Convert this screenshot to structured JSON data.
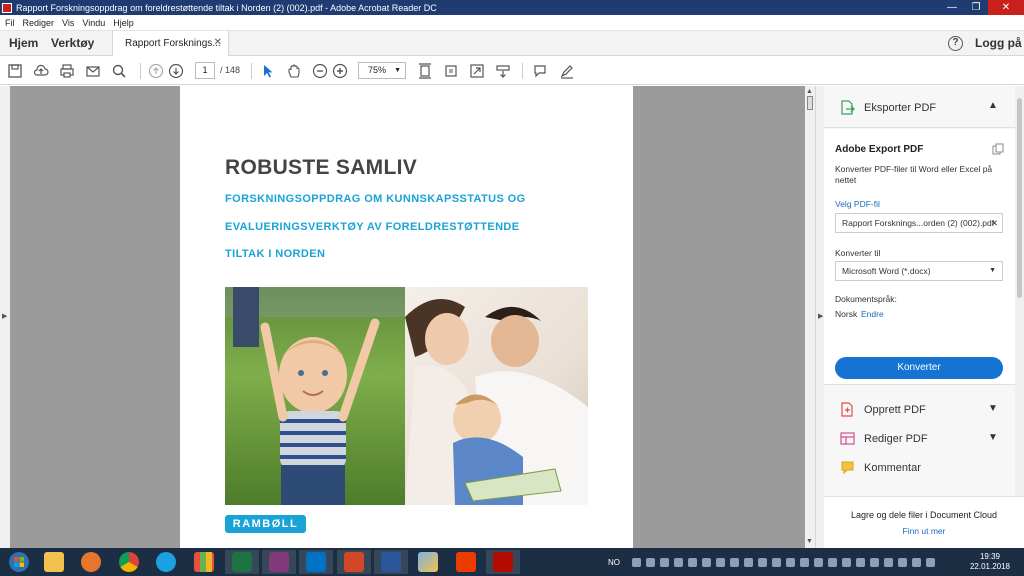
{
  "window": {
    "title": "Rapport Forskningsoppdrag om foreldrestøttende tiltak i Norden (2) (002).pdf - Adobe Acrobat Reader DC"
  },
  "menu": [
    "Fil",
    "Rediger",
    "Vis",
    "Vindu",
    "Hjelp"
  ],
  "tabs": {
    "home": "Hjem",
    "tools": "Verktøy",
    "document": "Rapport Forsknings...",
    "login": "Logg på"
  },
  "toolbar": {
    "page_current": "1",
    "page_total": "/ 148",
    "zoom": "75%"
  },
  "document": {
    "title": "ROBUSTE SAMLIV",
    "subtitle_lines": [
      "FORSKNINGSOPPDRAG OM KUNNSKAPSSTATUS OG",
      "EVALUERINGSVERKTØY AV FORELDRESTØTTENDE",
      "TILTAK I NORDEN"
    ],
    "logo": "RAMBØLL"
  },
  "panel": {
    "export_header": "Eksporter PDF",
    "export_title": "Adobe Export PDF",
    "export_desc": "Konverter PDF-filer til Word eller Excel på nettet",
    "select_pdf_link": "Velg PDF-fil",
    "file_value": "Rapport Forsknings...orden (2) (002).pdf",
    "convert_to_label": "Konverter til",
    "convert_format": "Microsoft Word (*.docx)",
    "doc_lang_label": "Dokumentspråk:",
    "doc_lang": "Norsk",
    "change_link": "Endre",
    "convert_button": "Konverter",
    "tools": [
      "Opprett PDF",
      "Rediger PDF",
      "Kommentar"
    ],
    "cloud_title": "Lagre og dele filer i Document Cloud",
    "cloud_link": "Finn ut mer"
  },
  "taskbar": {
    "lang": "NO",
    "time": "19:39",
    "date": "22.01.2018"
  },
  "colors": {
    "accent_blue": "#1aa3d6",
    "button_blue": "#1573d3",
    "titlebar": "#1f3b71",
    "taskbar": "#1b2e44"
  }
}
